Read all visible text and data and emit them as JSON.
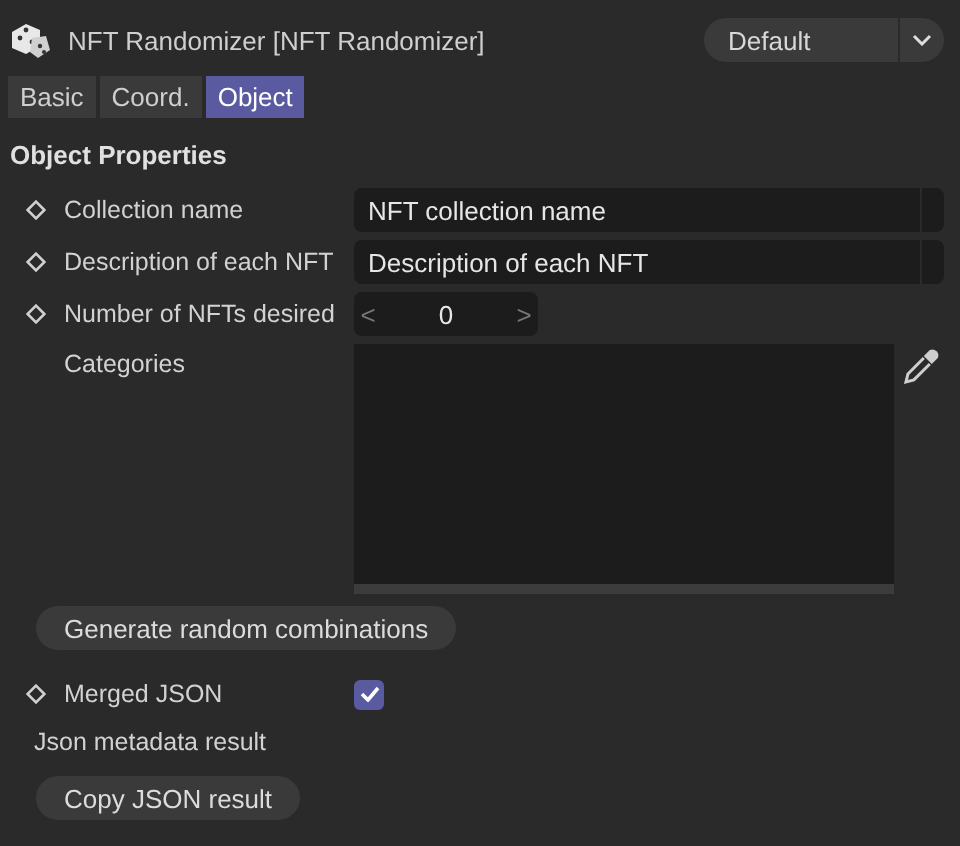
{
  "header": {
    "title": "NFT Randomizer [NFT Randomizer]",
    "preset": "Default"
  },
  "tabs": [
    {
      "label": "Basic",
      "selected": false
    },
    {
      "label": "Coord.",
      "selected": false
    },
    {
      "label": "Object",
      "selected": true
    }
  ],
  "section": {
    "title": "Object Properties"
  },
  "params": [
    {
      "kind": "text",
      "animatable": true,
      "label": "Collection name",
      "value": "NFT collection name"
    },
    {
      "kind": "text",
      "animatable": true,
      "label": "Description of each NFT",
      "value": "Description of each NFT"
    },
    {
      "kind": "stepper",
      "animatable": true,
      "label": "Number of NFTs desired",
      "value": "0",
      "prev": "<",
      "next": ">"
    },
    {
      "kind": "list",
      "animatable": false,
      "label": "Categories"
    },
    {
      "kind": "button",
      "label": "Generate random combinations"
    },
    {
      "kind": "checkbox",
      "animatable": true,
      "label": "Merged JSON",
      "checked": true
    },
    {
      "kind": "note",
      "label": "Json metadata result"
    },
    {
      "kind": "button",
      "label": "Copy JSON result"
    }
  ]
}
